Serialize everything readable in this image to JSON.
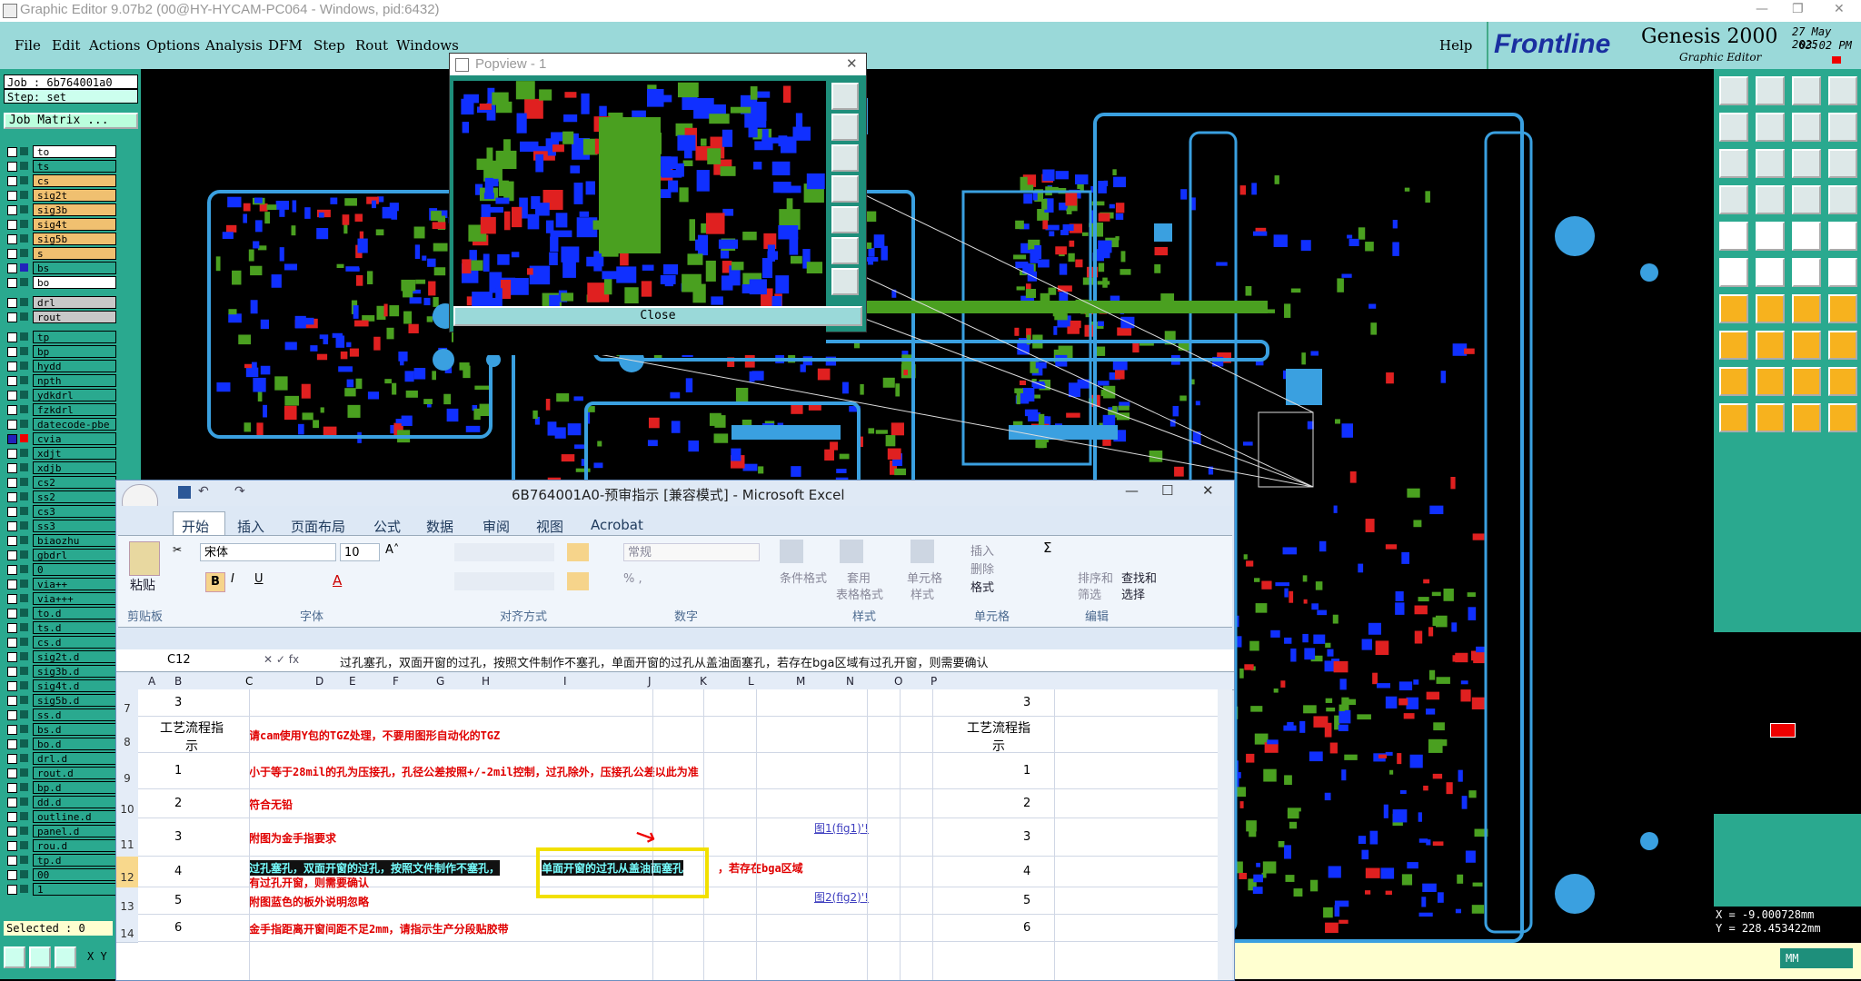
{
  "window_title": "Graphic Editor 9.07b2 (00@HY-HYCAM-PC064 - Windows, pid:6432)",
  "menu": [
    "File",
    "Edit",
    "Actions",
    "Options",
    "Analysis",
    "DFM",
    "Step",
    "Rout",
    "Windows"
  ],
  "help_label": "Help",
  "brand": {
    "logo": "Frontline",
    "product": "Genesis 2000",
    "subtitle": "Graphic Editor",
    "date": "27 May 2025",
    "time": "03:02 PM"
  },
  "job": {
    "job_label": "Job : 6b764001a0",
    "step_label": "Step: set",
    "matrix_button": "Job Matrix ..."
  },
  "layers": [
    {
      "name": "to",
      "color": "#ffffff"
    },
    {
      "name": "ts",
      "color": "#2aa98f"
    },
    {
      "name": "cs",
      "color": "#f0c070"
    },
    {
      "name": "sig2t",
      "color": "#f0c070"
    },
    {
      "name": "sig3b",
      "color": "#f0c070"
    },
    {
      "name": "sig4t",
      "color": "#f0c070"
    },
    {
      "name": "sig5b",
      "color": "#f0c070"
    },
    {
      "name": "s",
      "color": "#f0c070"
    },
    {
      "name": "bs",
      "color": "#2aa98f"
    },
    {
      "name": "bo",
      "color": "#ffffff"
    },
    {
      "name": "drl",
      "color": "#c8c8c8"
    },
    {
      "name": "rout",
      "color": "#c8c8c8"
    },
    {
      "name": "tp",
      "color": "#2aa98f"
    },
    {
      "name": "bp",
      "color": "#2aa98f"
    },
    {
      "name": "hydd",
      "color": "#2aa98f"
    },
    {
      "name": "npth",
      "color": "#2aa98f"
    },
    {
      "name": "ydkdrl",
      "color": "#2aa98f"
    },
    {
      "name": "fzkdrl",
      "color": "#2aa98f"
    },
    {
      "name": "datecode-pbe",
      "color": "#2aa98f"
    },
    {
      "name": "cvia",
      "color": "#2aa98f"
    },
    {
      "name": "xdjt",
      "color": "#2aa98f"
    },
    {
      "name": "xdjb",
      "color": "#2aa98f"
    },
    {
      "name": "cs2",
      "color": "#2aa98f"
    },
    {
      "name": "ss2",
      "color": "#2aa98f"
    },
    {
      "name": "cs3",
      "color": "#2aa98f"
    },
    {
      "name": "ss3",
      "color": "#2aa98f"
    },
    {
      "name": "biaozhu",
      "color": "#2aa98f"
    },
    {
      "name": "gbdrl",
      "color": "#2aa98f"
    },
    {
      "name": "0",
      "color": "#2aa98f"
    },
    {
      "name": "via++",
      "color": "#2aa98f"
    },
    {
      "name": "via+++",
      "color": "#2aa98f"
    },
    {
      "name": "to.d",
      "color": "#2aa98f"
    },
    {
      "name": "ts.d",
      "color": "#2aa98f"
    },
    {
      "name": "cs.d",
      "color": "#2aa98f"
    },
    {
      "name": "sig2t.d",
      "color": "#2aa98f"
    },
    {
      "name": "sig3b.d",
      "color": "#2aa98f"
    },
    {
      "name": "sig4t.d",
      "color": "#2aa98f"
    },
    {
      "name": "sig5b.d",
      "color": "#2aa98f"
    },
    {
      "name": "ss.d",
      "color": "#2aa98f"
    },
    {
      "name": "bs.d",
      "color": "#2aa98f"
    },
    {
      "name": "bo.d",
      "color": "#2aa98f"
    },
    {
      "name": "drl.d",
      "color": "#2aa98f"
    },
    {
      "name": "rout.d",
      "color": "#2aa98f"
    },
    {
      "name": "bp.d",
      "color": "#2aa98f"
    },
    {
      "name": "dd.d",
      "color": "#2aa98f"
    },
    {
      "name": "outline.d",
      "color": "#2aa98f"
    },
    {
      "name": "panel.d",
      "color": "#2aa98f"
    },
    {
      "name": "rou.d",
      "color": "#2aa98f"
    },
    {
      "name": "tp.d",
      "color": "#2aa98f"
    },
    {
      "name": "00",
      "color": "#2aa98f"
    },
    {
      "name": "1",
      "color": "#2aa98f"
    }
  ],
  "selected": "Selected : 0",
  "xy_label": "X Y",
  "popview": {
    "title": "Popview - 1",
    "close": "Close"
  },
  "coords": {
    "x": "X = -9.000728mm",
    "y": "Y = 228.453422mm"
  },
  "units": "MM",
  "excel": {
    "title": "6B764001A0-预审指示  [兼容模式] - Microsoft Excel",
    "tabs": [
      "开始",
      "插入",
      "页面布局",
      "公式",
      "数据",
      "审阅",
      "视图",
      "Acrobat"
    ],
    "clipboard": {
      "paste": "粘贴",
      "group": "剪贴板"
    },
    "font": {
      "name": "宋体",
      "size": "10",
      "group": "字体"
    },
    "align_group": "对齐方式",
    "number": {
      "format": "常规",
      "group": "数字"
    },
    "styles": {
      "cond": "条件格式",
      "table1": "套用",
      "table2": "表格格式",
      "cell1": "单元格",
      "cell2": "样式",
      "group": "样式"
    },
    "cells": {
      "insert": "插入",
      "delete": "删除",
      "format": "格式",
      "group": "单元格"
    },
    "edit": {
      "sort1": "排序和",
      "sort2": "筛选",
      "find1": "查找和",
      "find2": "选择",
      "group": "编辑"
    },
    "namebox": "C12",
    "formula": "过孔塞孔，双面开窗的过孔，按照文件制作不塞孔，单面开窗的过孔从盖油面塞孔，若存在bga区域有过孔开窗，则需要确认",
    "columns": [
      "A",
      "B",
      "C",
      "D",
      "E",
      "F",
      "G",
      "H",
      "I",
      "J",
      "K",
      "L",
      "M",
      "N",
      "O",
      "P"
    ],
    "rows": [
      {
        "num": "7",
        "b": "3",
        "m": "3"
      },
      {
        "num": "8",
        "a": "工艺流程指示",
        "c": "请cam使用Y包的TGZ处理，不要用图形自动化的TGZ",
        "l": "工艺流程指示"
      },
      {
        "num": "9",
        "b": "1",
        "c": "小于等于28mil的孔为压接孔，孔径公差按照+/-2mil控制，过孔除外，压接孔公差以此为准",
        "m": "1"
      },
      {
        "num": "10",
        "b": "2",
        "c": "符合无铅",
        "m": "2"
      },
      {
        "num": "11",
        "b": "3",
        "c": "附图为金手指要求",
        "j": "图1(fig1)'!",
        "m": "3"
      },
      {
        "num": "12",
        "b": "4",
        "c1": "过孔塞孔，双面开窗的过孔，按照文件制作不塞孔，",
        "c2": "单面开窗的过孔从盖油面塞孔",
        "c3": "，若存在bga区域",
        "c4": "有过孔开窗，则需要确认",
        "m": "4"
      },
      {
        "num": "13",
        "b": "5",
        "c": "附图蓝色的板外说明忽略",
        "j": "图2(fig2)'!",
        "m": "5"
      },
      {
        "num": "14",
        "b": "6",
        "c": "金手指距离开窗间距不足2mm，请指示生产分段贴胶带",
        "m": "6"
      }
    ]
  }
}
